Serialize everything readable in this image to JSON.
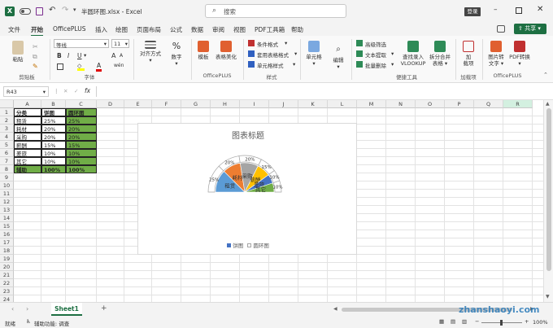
{
  "titlebar": {
    "filename": "半圆环图.xlsx",
    "separator": "-",
    "app": "Excel",
    "search_placeholder": "搜索",
    "login": "登录"
  },
  "menu": [
    "文件",
    "开始",
    "OfficePLUS",
    "插入",
    "绘图",
    "页面布局",
    "公式",
    "数据",
    "审阅",
    "视图",
    "PDF工具箱",
    "帮助"
  ],
  "share": "共享",
  "ribbon": {
    "clipboard": {
      "paste": "粘贴",
      "group": "剪贴板"
    },
    "font": {
      "name": "等线",
      "size": "11",
      "bold": "B",
      "italic": "I",
      "underline": "U",
      "grow": "A",
      "shrink": "A",
      "color": "A",
      "wen": "wén",
      "group": "字体"
    },
    "alignment": {
      "label": "对齐方式"
    },
    "number": {
      "label": "数字"
    },
    "officeplus1": {
      "template": "模板",
      "beautify": "表格美化",
      "group": "OfficePLUS"
    },
    "styles": {
      "cond": "条件格式",
      "table": "套用表格格式",
      "cell": "单元格样式",
      "group": "样式"
    },
    "cells": {
      "label": "单元格"
    },
    "editing": {
      "label": "编辑"
    },
    "tools": {
      "filter": "高级筛选",
      "extract": "文本提取",
      "batch": "批量删除",
      "vlookup1": "查找录入",
      "vlookup2": "VLOOKUP",
      "split1": "拆分合并",
      "split2": "表格",
      "group": "便捷工具"
    },
    "addins": {
      "label1": "加",
      "label2": "载项",
      "group": "加载项"
    },
    "officeplus2": {
      "img1": "图片转",
      "img2": "文字",
      "pdf1": "PDF转换",
      "group": "OfficePLUS"
    }
  },
  "formula": {
    "namebox": "R43",
    "fx": "fx",
    "value": ""
  },
  "columns": [
    "A",
    "B",
    "C",
    "D",
    "E",
    "F",
    "G",
    "H",
    "I",
    "J",
    "K",
    "L",
    "M",
    "N",
    "O",
    "P",
    "Q",
    "R"
  ],
  "rows": [
    "1",
    "2",
    "3",
    "4",
    "5",
    "6",
    "7",
    "8",
    "9",
    "10",
    "11",
    "12",
    "13",
    "14",
    "15",
    "16",
    "17",
    "18",
    "19",
    "20",
    "21",
    "22",
    "23",
    "24"
  ],
  "table": {
    "headers": [
      "分类",
      "饼图",
      "圆环图"
    ],
    "rows": [
      [
        "租赁",
        "25%",
        "25%"
      ],
      [
        "耗材",
        "20%",
        "20%"
      ],
      [
        "采购",
        "20%",
        "20%"
      ],
      [
        "薪酬",
        "15%",
        "15%"
      ],
      [
        "差旅",
        "10%",
        "10%"
      ],
      [
        "其它",
        "10%",
        "10%"
      ],
      [
        "辅助",
        "100%",
        "100%"
      ]
    ]
  },
  "chart_data": {
    "type": "pie",
    "title": "图表标题",
    "categories": [
      "租赁",
      "耗材",
      "采购",
      "薪酬",
      "差旅",
      "其它"
    ],
    "series": [
      {
        "name": "饼图",
        "values": [
          25,
          20,
          20,
          15,
          10,
          10
        ]
      },
      {
        "name": "圆环图",
        "values": [
          25,
          20,
          20,
          15,
          10,
          10
        ]
      }
    ],
    "labels": [
      "25%",
      "20%",
      "20%",
      "15%",
      "10%",
      "10%"
    ],
    "legend": "bottom",
    "colors": [
      "#5b9bd5",
      "#ed7d31",
      "#a5a5a5",
      "#ffc000",
      "#4472c4",
      "#70ad47"
    ]
  },
  "sheet": {
    "tab": "Sheet1",
    "add": "+"
  },
  "status": {
    "ready": "就绪",
    "accessibility": "辅助功能: 调查",
    "zoom": "100%"
  },
  "watermark": "zhanshaoyi.com"
}
